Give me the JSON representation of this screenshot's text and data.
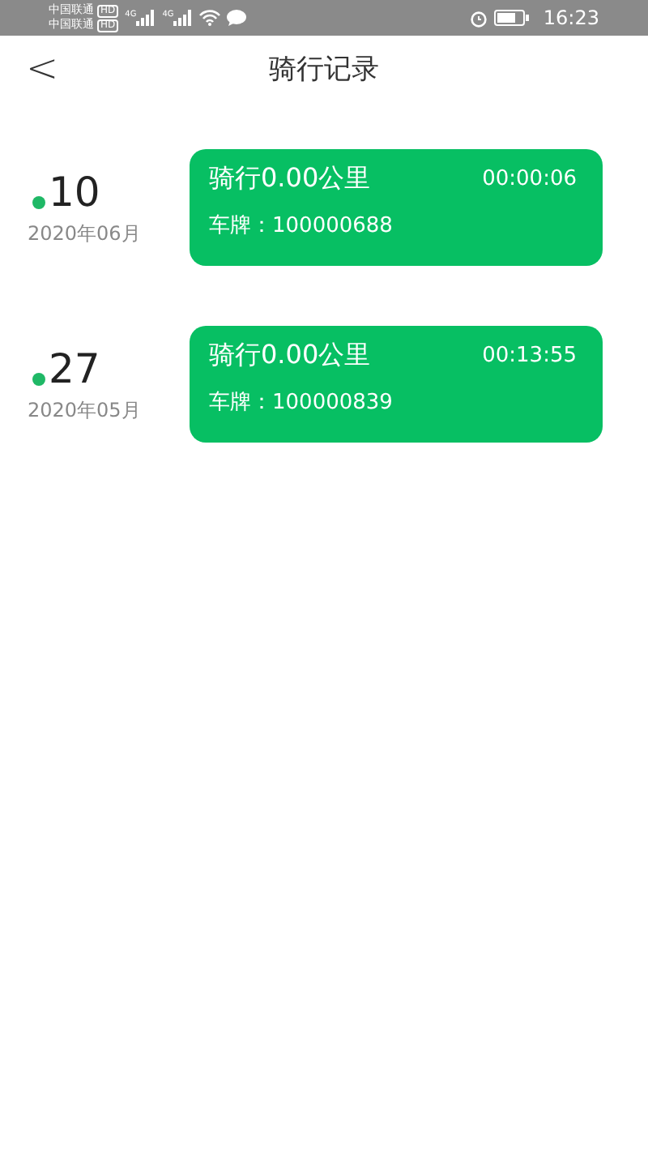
{
  "status_bar": {
    "carriers": [
      {
        "name": "中国联通",
        "badge": "HD"
      },
      {
        "name": "中国联通",
        "badge": "HD"
      }
    ],
    "network_labels": [
      "4G",
      "4G"
    ],
    "time": "16:23"
  },
  "header": {
    "back": "<",
    "title": "骑行记录"
  },
  "records": [
    {
      "day": "10",
      "month": "2020年06月",
      "distance": "骑行0.00公里",
      "duration": "00:00:06",
      "plate": "车牌：100000688"
    },
    {
      "day": "27",
      "month": "2020年05月",
      "distance": "骑行0.00公里",
      "duration": "00:13:55",
      "plate": "车牌：100000839"
    }
  ]
}
